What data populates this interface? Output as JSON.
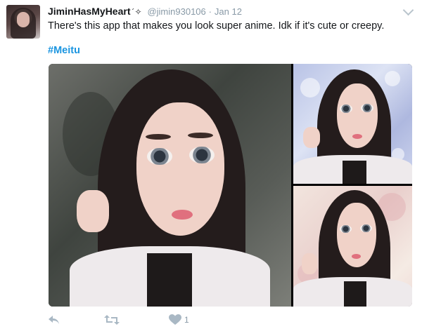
{
  "tweet": {
    "display_name": "JiminHasMyHeart",
    "name_suffix": "´✧",
    "handle": "@jimin930106",
    "separator": "·",
    "date": "Jan 12",
    "text": "There's this app that makes you look super anime. Idk if it's cute or creepy.",
    "hashtag": "#Meitu"
  },
  "actions": {
    "reply_icon": "reply-icon",
    "retweet_icon": "retweet-icon",
    "like_icon": "heart-icon",
    "like_count": "1"
  },
  "colors": {
    "link": "#1b95e0",
    "muted": "#8899a6",
    "icon": "#a9b8c4"
  }
}
